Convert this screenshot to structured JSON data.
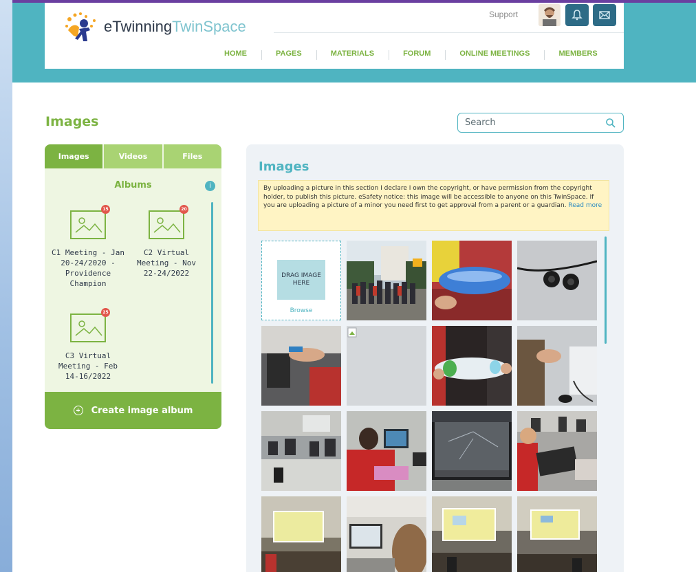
{
  "header": {
    "logo_prefix": "eTwinning",
    "logo_suffix": "TwinSpace",
    "support_label": "Support",
    "nav": [
      "HOME",
      "PAGES",
      "MATERIALS",
      "FORUM",
      "ONLINE MEETINGS",
      "MEMBERS"
    ]
  },
  "page": {
    "title": "Images",
    "search_placeholder": "Search"
  },
  "sidebar": {
    "tabs": [
      "Images",
      "Videos",
      "Files"
    ],
    "albums_title": "Albums",
    "albums": [
      {
        "name": "C1 Meeting - Jan 20-24/2020 - Providence Champion",
        "count": "15"
      },
      {
        "name": "C2 Virtual Meeting - Nov 22-24/2022",
        "count": "20"
      },
      {
        "name": "C3 Virtual Meeting - Feb 14-16/2022",
        "count": "25"
      }
    ],
    "create_label": "Create image album"
  },
  "main": {
    "title": "Images",
    "notice_text": "By uploading a picture in this section I declare I own the copyright, or have permission from the copyright holder, to publish this picture. eSafety notice: this image will be accessible to anyone on this TwinSpace. If you are uploading a picture of a minor you need first to get approval from a parent or a guardian.",
    "notice_link": "Read more",
    "drop_label": "DRAG IMAGE HERE",
    "browse_label": "Browse"
  },
  "colors": {
    "accent_green": "#7cb342",
    "accent_teal": "#4fb4c1",
    "notice_bg": "#fff4c4"
  }
}
